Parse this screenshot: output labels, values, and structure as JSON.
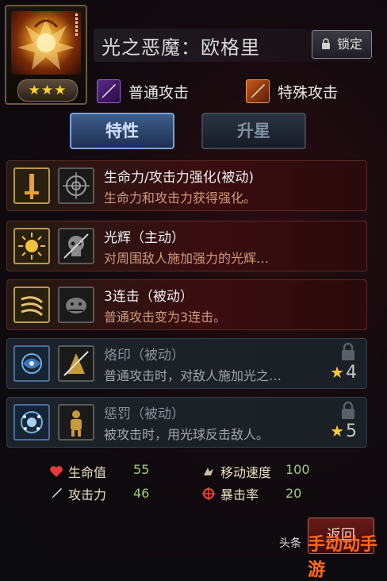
{
  "hero": {
    "name": "光之恶魔：欧格里",
    "stars": "★★★",
    "lock_label": "锁定"
  },
  "attacks": {
    "normal": "普通攻击",
    "special": "特殊攻击"
  },
  "tabs": {
    "traits": "特性",
    "star_up": "升星"
  },
  "skills": [
    {
      "name": "生命力/攻击力强化(被动)",
      "desc": "生命力和攻击力获得强化。",
      "locked": false
    },
    {
      "name": "光辉（主动）",
      "desc": "对周围敌人施加强力的光辉…",
      "locked": false
    },
    {
      "name": "3连击（被动）",
      "desc": "普通攻击变为3连击。",
      "locked": false
    },
    {
      "name": "烙印（被动）",
      "desc": "普通攻击时，对敌人施加光之…",
      "locked": true,
      "req": "4"
    },
    {
      "name": "惩罚（被动）",
      "desc": "被攻击时，用光球反击敌人。",
      "locked": true,
      "req": "5"
    }
  ],
  "stats": {
    "hp_label": "生命值",
    "hp_value": "55",
    "atk_label": "攻击力",
    "atk_value": "46",
    "speed_label": "移动速度",
    "speed_value": "100",
    "crit_label": "暴击率",
    "crit_value": "20"
  },
  "back_label": "返回",
  "watermark": {
    "prefix": "头条",
    "brand": "手动动手游"
  },
  "colors": {
    "accent": "#7aa4d8",
    "star": "#ffc83a",
    "value": "#9ad07a"
  }
}
